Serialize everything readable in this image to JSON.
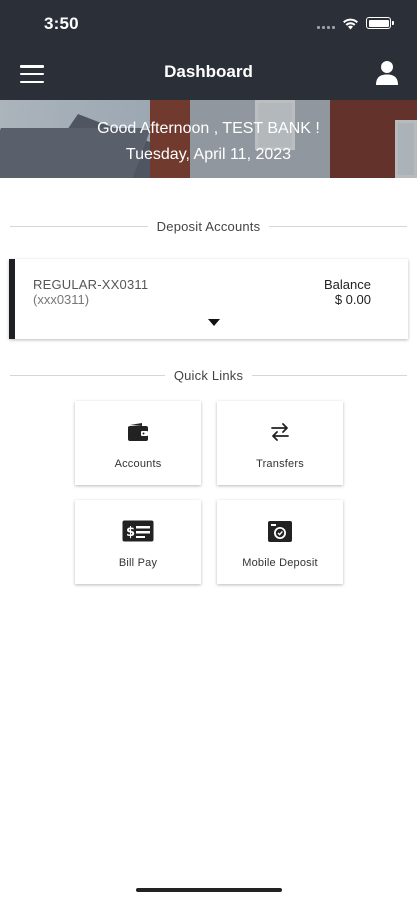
{
  "status_bar": {
    "time": "3:50"
  },
  "nav": {
    "title": "Dashboard",
    "menu_icon": "hamburger-menu-icon",
    "profile_icon": "user-profile-icon"
  },
  "banner": {
    "greeting": "Good Afternoon , TEST BANK !",
    "date": "Tuesday, April 11, 2023"
  },
  "deposit_section": {
    "heading": "Deposit Accounts",
    "accounts": [
      {
        "name": "REGULAR-XX0311",
        "number": "(xxx0311)",
        "balance_label": "Balance",
        "balance": "$ 0.00"
      }
    ]
  },
  "quick_links": {
    "heading": "Quick Links",
    "items": [
      {
        "label": "Accounts",
        "icon": "wallet-icon"
      },
      {
        "label": "Transfers",
        "icon": "transfer-arrows-icon"
      },
      {
        "label": "Bill Pay",
        "icon": "bill-pay-icon"
      },
      {
        "label": "Mobile Deposit",
        "icon": "mobile-deposit-camera-icon"
      }
    ]
  },
  "colors": {
    "header_bg": "#2b2f38",
    "accent_bar": "#1e1f22",
    "background": "#ffffff"
  }
}
